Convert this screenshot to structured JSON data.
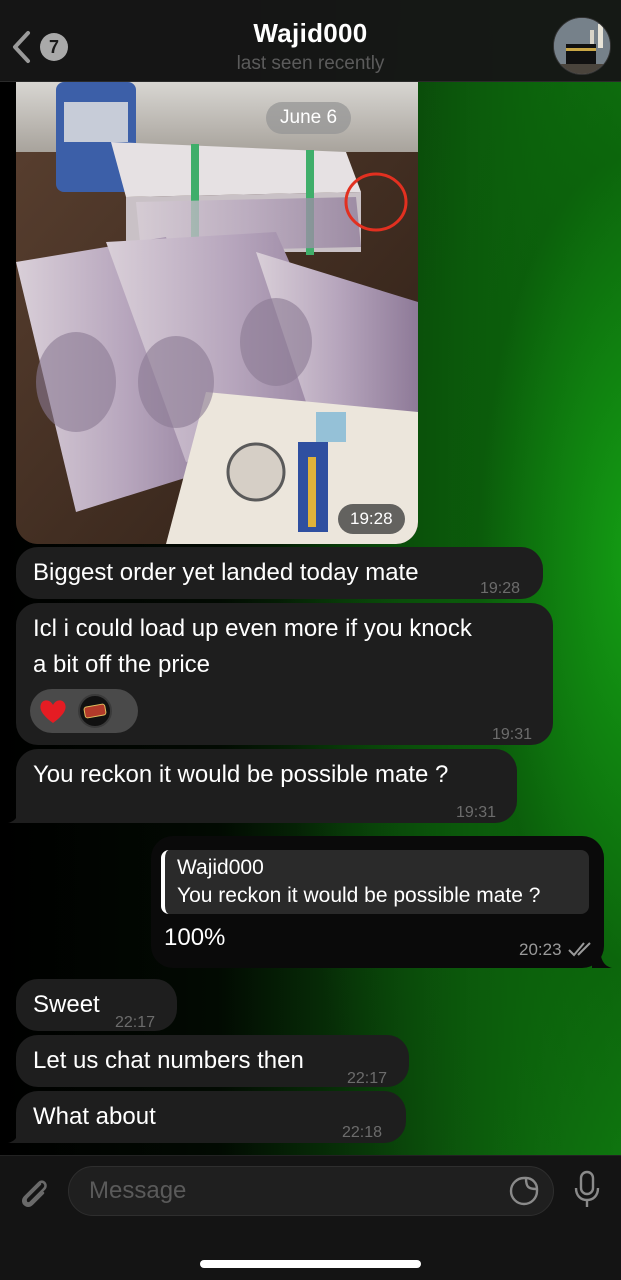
{
  "header": {
    "back_count": "7",
    "title": "Wajid000",
    "subtitle": "last seen recently",
    "avatar_icon": "kaaba-avatar"
  },
  "date_separator": "June 6",
  "messages": [
    {
      "type": "photo",
      "time": "19:28",
      "direction": "incoming"
    },
    {
      "type": "text",
      "text": "Biggest order yet landed today mate",
      "time": "19:28",
      "direction": "incoming"
    },
    {
      "type": "text",
      "line1": "Icl i could load up even more if you knock",
      "line2": "a bit off the price",
      "time": "19:31",
      "direction": "incoming",
      "reactions": [
        "heart",
        "user-avatar"
      ]
    },
    {
      "type": "text",
      "text": "You reckon it would be possible mate ?",
      "time": "19:31",
      "direction": "incoming"
    },
    {
      "type": "reply",
      "quote_name": "Wajid000",
      "quote_text": "You reckon it would be possible mate ?",
      "text": "100%",
      "time": "20:23",
      "direction": "outgoing",
      "status": "read"
    },
    {
      "type": "text",
      "text": "Sweet",
      "time": "22:17",
      "direction": "incoming"
    },
    {
      "type": "text",
      "text": "Let us chat numbers then",
      "time": "22:17",
      "direction": "incoming"
    },
    {
      "type": "text",
      "text": "What about",
      "time": "22:18",
      "direction": "incoming"
    }
  ],
  "input": {
    "placeholder": "Message"
  },
  "colors": {
    "incoming_bubble": "#1e1e1e",
    "outgoing_bubble": "#0a0a0a",
    "wallpaper_green": "#138c13"
  }
}
